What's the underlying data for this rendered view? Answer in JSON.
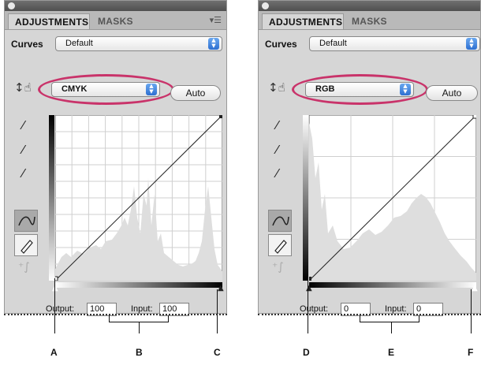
{
  "panels": [
    {
      "tabs": [
        "ADJUSTMENTS",
        "MASKS"
      ],
      "curves_label": "Curves",
      "preset": "Default",
      "channel": "CMYK",
      "auto_label": "Auto",
      "output_label": "Output:",
      "output_value": "100",
      "input_label": "Input:",
      "input_value": "100"
    },
    {
      "tabs": [
        "ADJUSTMENTS",
        "MASKS"
      ],
      "curves_label": "Curves",
      "preset": "Default",
      "channel": "RGB",
      "auto_label": "Auto",
      "output_label": "Output:",
      "output_value": "0",
      "input_label": "Input:",
      "input_value": "0"
    }
  ],
  "callouts": [
    "A",
    "B",
    "C",
    "D",
    "E",
    "F"
  ],
  "colors": {
    "highlight_ellipse": "#c9336a",
    "popup_arrow": "#2d6fd1",
    "panel_bg": "#d6d6d6"
  },
  "icons": [
    "hand-target-icon",
    "eyedropper-black-icon",
    "eyedropper-gray-icon",
    "eyedropper-white-icon",
    "curve-point-icon",
    "pencil-icon",
    "smooth-curve-icon",
    "panel-menu-icon",
    "collapse-icon"
  ]
}
